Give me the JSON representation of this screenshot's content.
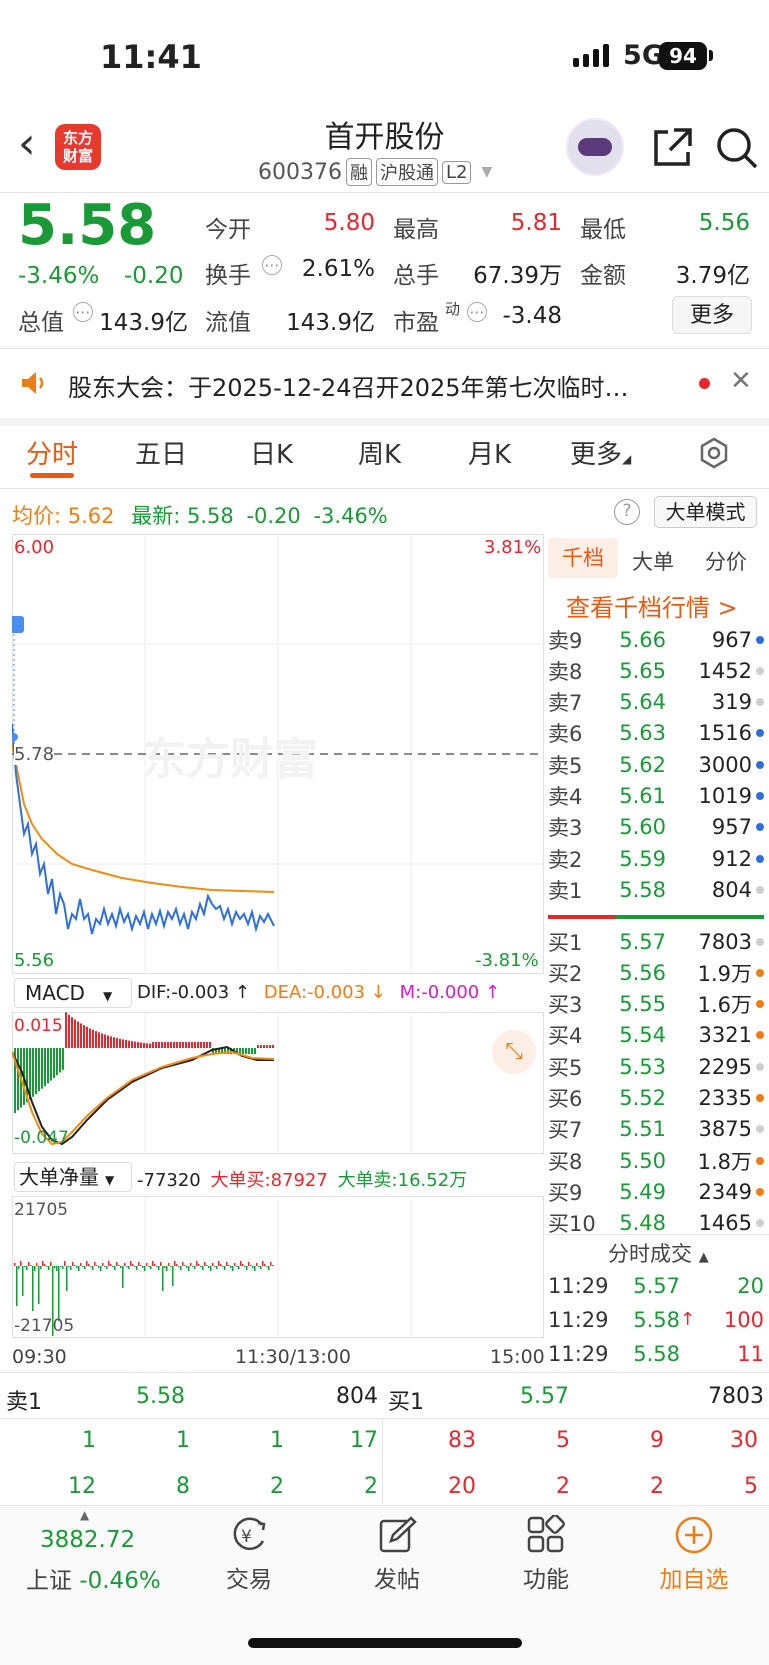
{
  "status": {
    "time": "11:41",
    "network": "5G",
    "battery": "94"
  },
  "header": {
    "logo_text": "东方\n财富",
    "name": "首开股份",
    "code": "600376",
    "tags": [
      "融",
      "沪股通",
      "L2"
    ]
  },
  "quote": {
    "price": "5.58",
    "change_pct": "-3.46%",
    "change": "-0.20",
    "fields": [
      {
        "label": "今开",
        "value": "5.80",
        "color": "red"
      },
      {
        "label": "最高",
        "value": "5.81",
        "color": "red"
      },
      {
        "label": "最低",
        "value": "5.56",
        "color": "green"
      },
      {
        "label": "换手",
        "value": "2.61%",
        "color": "normal"
      },
      {
        "label": "总手",
        "value": "67.39万",
        "color": "normal"
      },
      {
        "label": "金额",
        "value": "3.79亿",
        "color": "normal"
      },
      {
        "label": "总值",
        "value": "143.9亿",
        "color": "normal"
      },
      {
        "label": "流值",
        "value": "143.9亿",
        "color": "normal"
      },
      {
        "label": "市盈",
        "label_sup": "动",
        "value": "-3.48",
        "color": "normal"
      }
    ],
    "more_button": "更多"
  },
  "notice": {
    "text": "股东大会：于2025-12-24召开2025年第七次临时…"
  },
  "tabs": [
    "分时",
    "五日",
    "日K",
    "周K",
    "月K",
    "更多"
  ],
  "active_tab": 0,
  "infobar": {
    "avg_label": "均价:",
    "avg_value": "5.62",
    "latest_label": "最新:",
    "latest_value": "5.58",
    "latest_change": "-0.20",
    "latest_pct": "-3.46%",
    "mode_button": "大单模式"
  },
  "chart_labels": {
    "top_price": "6.00",
    "top_pct": "3.81%",
    "mid_price": "5.78",
    "low_price": "5.56",
    "low_pct": "-3.81%",
    "watermark": "东方财富",
    "macd_select": "MACD",
    "dif": "DIF:-0.003 ↑",
    "dea": "DEA:-0.003 ↓",
    "m": "M:-0.000 ↑",
    "macd_top": "0.015",
    "macd_bottom": "-0.047",
    "flow_select": "大单净量",
    "flow_net": "-77320",
    "flow_buy": "大单买:87927",
    "flow_sell": "大单卖:16.52万",
    "flow_top": "21705",
    "flow_bottom": "-21705",
    "time_start": "09:30",
    "time_mid": "11:30/13:00",
    "time_end": "15:00"
  },
  "orderbook": {
    "tabs": [
      "千档",
      "大单",
      "分价"
    ],
    "link": "查看千档行情 >",
    "asks": [
      {
        "label": "卖9",
        "price": "5.66",
        "vol": "967",
        "dot": "blue"
      },
      {
        "label": "卖8",
        "price": "5.65",
        "vol": "1452",
        "dot": "gray"
      },
      {
        "label": "卖7",
        "price": "5.64",
        "vol": "319",
        "dot": "gray"
      },
      {
        "label": "卖6",
        "price": "5.63",
        "vol": "1516",
        "dot": "blue"
      },
      {
        "label": "卖5",
        "price": "5.62",
        "vol": "3000",
        "dot": "blue"
      },
      {
        "label": "卖4",
        "price": "5.61",
        "vol": "1019",
        "dot": "blue"
      },
      {
        "label": "卖3",
        "price": "5.60",
        "vol": "957",
        "dot": "blue"
      },
      {
        "label": "卖2",
        "price": "5.59",
        "vol": "912",
        "dot": "blue"
      },
      {
        "label": "卖1",
        "price": "5.58",
        "vol": "804",
        "dot": "gray"
      }
    ],
    "bids": [
      {
        "label": "买1",
        "price": "5.57",
        "vol": "7803",
        "dot": "gray"
      },
      {
        "label": "买2",
        "price": "5.56",
        "vol": "1.9万",
        "dot": "orange"
      },
      {
        "label": "买3",
        "price": "5.55",
        "vol": "1.6万",
        "dot": "orange"
      },
      {
        "label": "买4",
        "price": "5.54",
        "vol": "3321",
        "dot": "orange"
      },
      {
        "label": "买5",
        "price": "5.53",
        "vol": "2295",
        "dot": "gray"
      },
      {
        "label": "买6",
        "price": "5.52",
        "vol": "2335",
        "dot": "orange"
      },
      {
        "label": "买7",
        "price": "5.51",
        "vol": "3875",
        "dot": "gray"
      },
      {
        "label": "买8",
        "price": "5.50",
        "vol": "1.8万",
        "dot": "orange"
      },
      {
        "label": "买9",
        "price": "5.49",
        "vol": "2349",
        "dot": "orange"
      },
      {
        "label": "买10",
        "price": "5.48",
        "vol": "1465",
        "dot": "gray"
      }
    ],
    "trades_title": "分时成交",
    "trades": [
      {
        "time": "11:29",
        "price": "5.57",
        "arrow": "",
        "vol": "20",
        "vol_color": "green"
      },
      {
        "time": "11:29",
        "price": "5.58",
        "arrow": "↑",
        "vol": "100",
        "vol_color": "red"
      },
      {
        "time": "11:29",
        "price": "5.58",
        "arrow": "",
        "vol": "11",
        "vol_color": "red"
      }
    ]
  },
  "level_bar": {
    "sell_label": "卖1",
    "sell_price": "5.58",
    "sell_vol": "804",
    "buy_label": "买1",
    "buy_price": "5.57",
    "buy_vol": "7803",
    "sell_queue_1": [
      "1",
      "1",
      "1",
      "17"
    ],
    "sell_queue_2": [
      "12",
      "8",
      "2",
      "2"
    ],
    "buy_queue_1": [
      "83",
      "5",
      "9",
      "30"
    ],
    "buy_queue_2": [
      "20",
      "2",
      "2",
      "5"
    ]
  },
  "bottom_nav": {
    "index_value": "3882.72",
    "index_name": "上证",
    "index_change": "-0.46%",
    "items": [
      "交易",
      "发帖",
      "功能",
      "加自选"
    ]
  }
}
